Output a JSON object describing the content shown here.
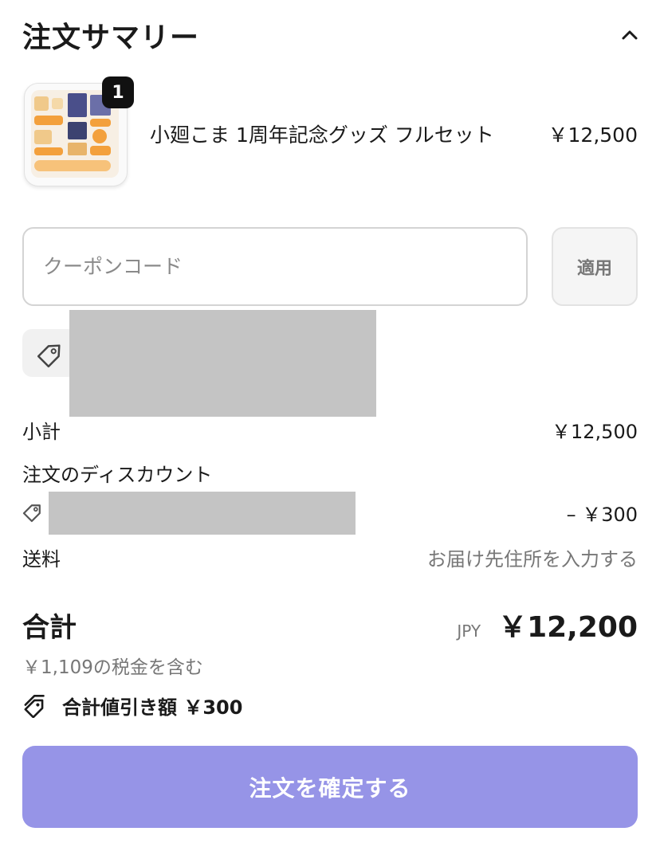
{
  "header": {
    "title": "注文サマリー"
  },
  "item": {
    "quantity": "1",
    "name": "小廻こま 1周年記念グッズ フルセット",
    "price": "￥12,500"
  },
  "coupon": {
    "placeholder": "クーポンコード",
    "apply_label": "適用"
  },
  "summary": {
    "subtotal_label": "小計",
    "subtotal_value": "￥12,500",
    "discount_label": "注文のディスカウント",
    "discount_value": "– ￥300",
    "shipping_label": "送料",
    "shipping_value": "お届け先住所を入力する"
  },
  "total": {
    "label": "合計",
    "currency": "JPY",
    "amount": "￥12,200",
    "tax_note": "￥1,109の税金を含む",
    "savings": "合計値引き額 ￥300"
  },
  "actions": {
    "confirm_label": "注文を確定する"
  },
  "colors": {
    "confirm_bg": "#9694e7",
    "muted_text": "#777777",
    "redacted": "#c4c4c4"
  },
  "icons": [
    "chevron-up-icon",
    "tag-icon",
    "tags-icon"
  ]
}
